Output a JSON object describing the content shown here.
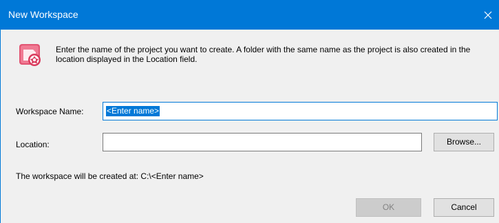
{
  "window": {
    "title": "New Workspace",
    "close_icon": "close-icon"
  },
  "header": {
    "icon": "workspace-app-icon",
    "description": "Enter the name of the project you want to create. A folder with the same name as the project is also created in the location displayed in the Location field."
  },
  "form": {
    "workspace_name_label": "Workspace Name:",
    "workspace_name_value": "<Enter name>",
    "location_label": "Location:",
    "location_value": "",
    "browse_label": "Browse...",
    "result_text": "The workspace will be created at: C:\\<Enter name>"
  },
  "footer": {
    "ok_label": "OK",
    "ok_enabled": false,
    "cancel_label": "Cancel"
  },
  "colors": {
    "titlebar": "#0078d7",
    "dialog_bg": "#f0f0f0",
    "selection": "#0078d7"
  }
}
